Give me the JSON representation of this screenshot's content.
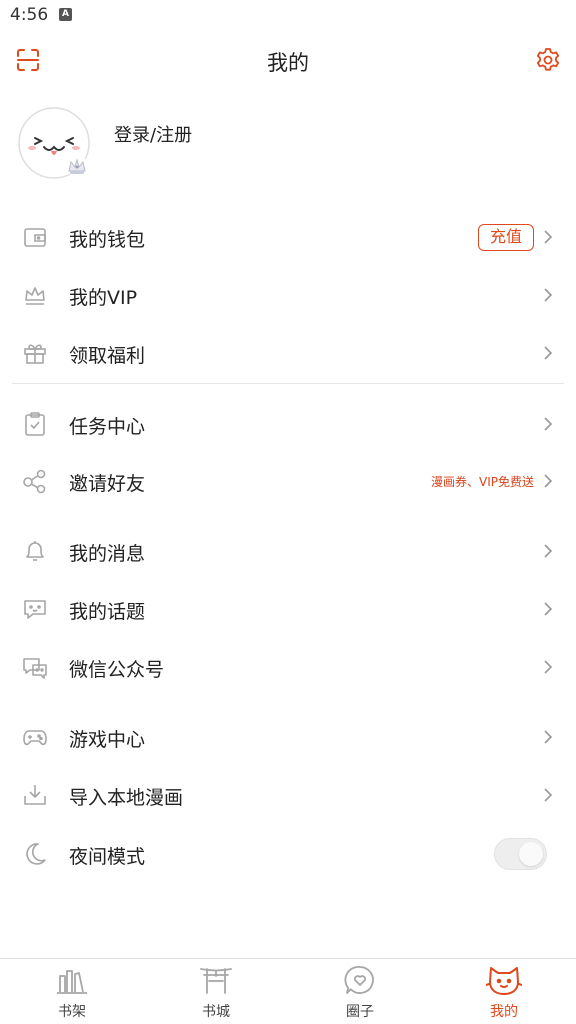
{
  "status_bar": {
    "time": "4:56",
    "indicator": "A"
  },
  "header": {
    "title": "我的",
    "scan_icon": "scan-icon",
    "settings_icon": "gear-icon"
  },
  "profile": {
    "login_text": "登录/注册"
  },
  "menu": {
    "wallet": {
      "label": "我的钱包",
      "badge": "充值"
    },
    "vip": {
      "label": "我的VIP"
    },
    "welfare": {
      "label": "领取福利"
    },
    "tasks": {
      "label": "任务中心"
    },
    "invite": {
      "label": "邀请好友",
      "promo": "漫画券、VIP免费送"
    },
    "messages": {
      "label": "我的消息"
    },
    "topics": {
      "label": "我的话题"
    },
    "wechat": {
      "label": "微信公众号"
    },
    "games": {
      "label": "游戏中心"
    },
    "import": {
      "label": "导入本地漫画"
    },
    "night_mode": {
      "label": "夜间模式",
      "enabled": false
    }
  },
  "tabs": [
    {
      "label": "书架",
      "icon": "bookshelf-icon",
      "active": false
    },
    {
      "label": "书城",
      "icon": "bookstore-icon",
      "active": false
    },
    {
      "label": "圈子",
      "icon": "circle-icon",
      "active": false
    },
    {
      "label": "我的",
      "icon": "cat-face-icon",
      "active": true
    }
  ],
  "colors": {
    "accent": "#e0491b",
    "icon_gray": "#a6a6a6",
    "text": "#222222"
  }
}
